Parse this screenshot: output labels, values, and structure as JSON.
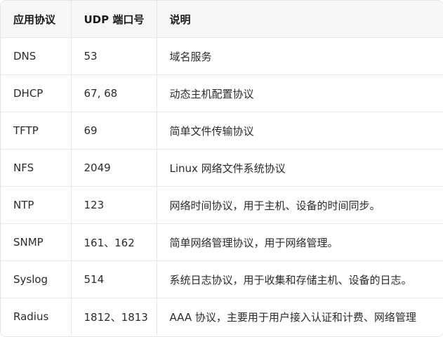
{
  "table": {
    "headers": [
      "应用协议",
      "UDP 端口号",
      "说明"
    ],
    "rows": [
      {
        "protocol": "DNS",
        "port": "53",
        "desc": "域名服务"
      },
      {
        "protocol": "DHCP",
        "port": "67, 68",
        "desc": "动态主机配置协议"
      },
      {
        "protocol": "TFTP",
        "port": "69",
        "desc": "简单文件传输协议"
      },
      {
        "protocol": "NFS",
        "port": "2049",
        "desc": "Linux 网络文件系统协议"
      },
      {
        "protocol": "NTP",
        "port": "123",
        "desc": "网络时间协议，用于主机、设备的时间同步。"
      },
      {
        "protocol": "SNMP",
        "port": "161、162",
        "desc": "简单网络管理协议，用于网络管理。"
      },
      {
        "protocol": "Syslog",
        "port": "514",
        "desc": "系统日志协议，用于收集和存储主机、设备的日志。"
      },
      {
        "protocol": "Radius",
        "port": "1812、1813",
        "desc": "AAA 协议，主要用于用户接入认证和计费、网络管理"
      }
    ]
  }
}
